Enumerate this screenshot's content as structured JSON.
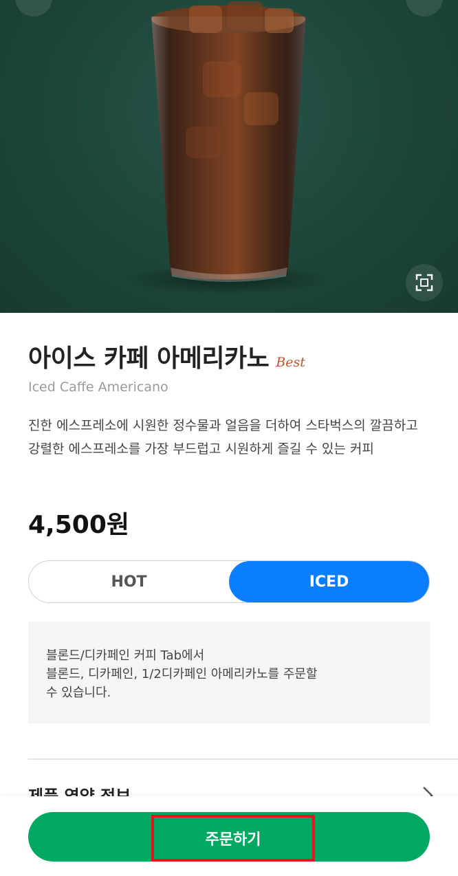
{
  "product": {
    "name_ko": "아이스 카페 아메리카노",
    "badge": "Best",
    "name_en": "Iced Caffe Americano",
    "description": "진한 에스프레소에 시원한 정수물과 얼음을 더하여 스타벅스의 깔끔하고 강렬한 에스프레소를 가장 부드럽고 시원하게 즐길 수 있는 커피",
    "price": "4,500원"
  },
  "temperature": {
    "options": [
      "HOT",
      "ICED"
    ],
    "selected": "ICED"
  },
  "notice": {
    "line1": "블론드/디카페인 커피 Tab에서",
    "line2": "블론드, 디카페인, 1/2디카페인 아메리카노를 주문할",
    "line3": "수 있습니다."
  },
  "nutrition": {
    "label": "제품 영양 정보"
  },
  "order": {
    "label": "주문하기"
  },
  "colors": {
    "accent_green": "#00a862",
    "toggle_active": "#0b7dff",
    "hero_background": "#1d4539",
    "badge": "#c0522d",
    "highlight_border": "#e8141e"
  },
  "icons": {
    "back": "back-icon",
    "share": "share-icon",
    "expand": "expand-icon",
    "chevron": "chevron-right-icon"
  }
}
